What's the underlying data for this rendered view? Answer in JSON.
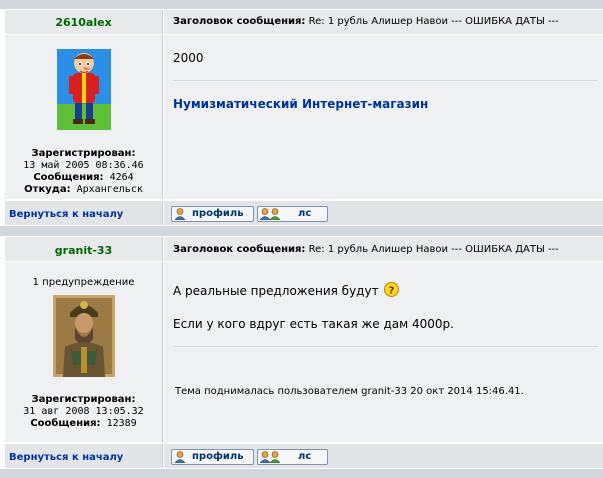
{
  "posts": [
    {
      "username": "2610alex",
      "subject_label": "Заголовок сообщения:",
      "subject_text": "Re: 1 рубль Алишер Навои --- ОШИБКА ДАТЫ ---",
      "registered_label": "Зарегистрирован:",
      "registered_value": "13 май 2005 08:36.46",
      "posts_label": "Сообщения:",
      "posts_value": "4264",
      "from_label": "Откуда:",
      "from_value": "Архангельск",
      "body_line1": "2000",
      "link_text": "Нумизматический Интернет-магазин",
      "back_label": "Вернуться к началу",
      "profile_label": "профиль",
      "pm_label": "лс"
    },
    {
      "username": "granit-33",
      "subject_label": "Заголовок сообщения:",
      "subject_text": "Re: 1 рубль Алишер Навои --- ОШИБКА ДАТЫ ---",
      "warning": "1 предупреждение",
      "registered_label": "Зарегистрирован:",
      "registered_value": "31 авг 2008 13:05.32",
      "posts_label": "Сообщения:",
      "posts_value": "12389",
      "body_line1": "А реальные предложения будут",
      "body_line2": "Если у кого вдруг есть такая же дам 4000р.",
      "bump_note": "Тема поднималась пользователем granit-33 20 окт 2014 15:46.41.",
      "back_label": "Вернуться к началу",
      "profile_label": "профиль",
      "pm_label": "лс"
    }
  ],
  "colors": {
    "username": "#006600",
    "link": "#003399",
    "row_bg": "#eff0f1"
  },
  "icons": {
    "profile": "profile-user-icon",
    "pm": "private-message-users-icon",
    "smiley": "question-smiley-icon"
  }
}
